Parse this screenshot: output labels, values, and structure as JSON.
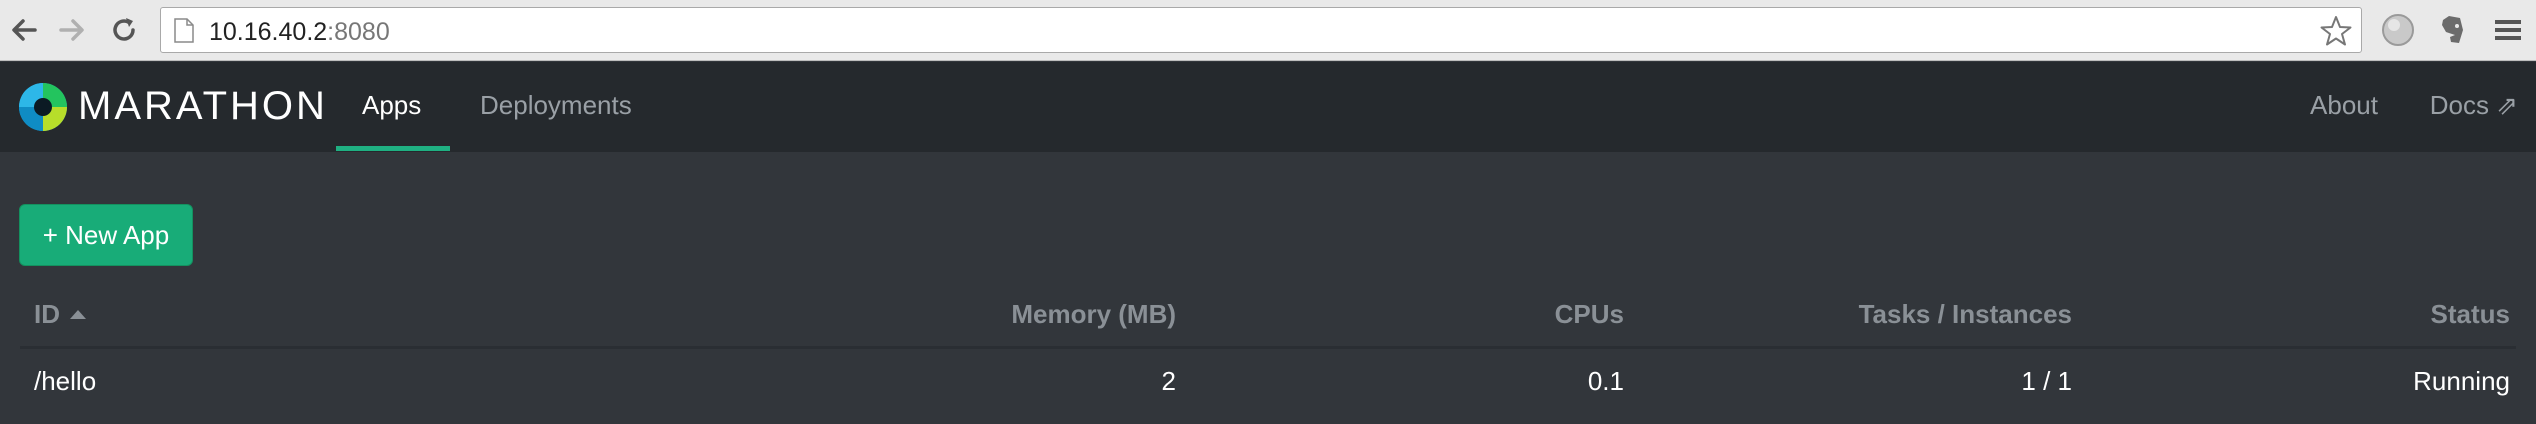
{
  "browser": {
    "url_host": "10.16.40.2",
    "url_port": ":8080"
  },
  "navbar": {
    "brand": "MARATHON",
    "tabs": [
      {
        "label": "Apps",
        "active": true
      },
      {
        "label": "Deployments",
        "active": false
      }
    ],
    "about_label": "About",
    "docs_label": "Docs ⇗"
  },
  "toolbar": {
    "new_app_label": "+ New App"
  },
  "table": {
    "columns": [
      "ID",
      "Memory (MB)",
      "CPUs",
      "Tasks / Instances",
      "Status"
    ],
    "rows": [
      {
        "id": "/hello",
        "memory": "2",
        "cpus": "0.1",
        "tasks": "1 / 1",
        "status": "Running"
      }
    ]
  },
  "colors": {
    "accent": "#18ac78",
    "navbar_bg": "#25292d",
    "content_bg": "#32363b"
  },
  "icons": [
    "back-arrow-icon",
    "forward-arrow-icon",
    "reload-icon",
    "page-icon",
    "star-icon",
    "globe-icon",
    "evernote-icon",
    "menu-icon",
    "marathon-logo-icon",
    "external-link-icon",
    "sort-ascending-icon"
  ]
}
